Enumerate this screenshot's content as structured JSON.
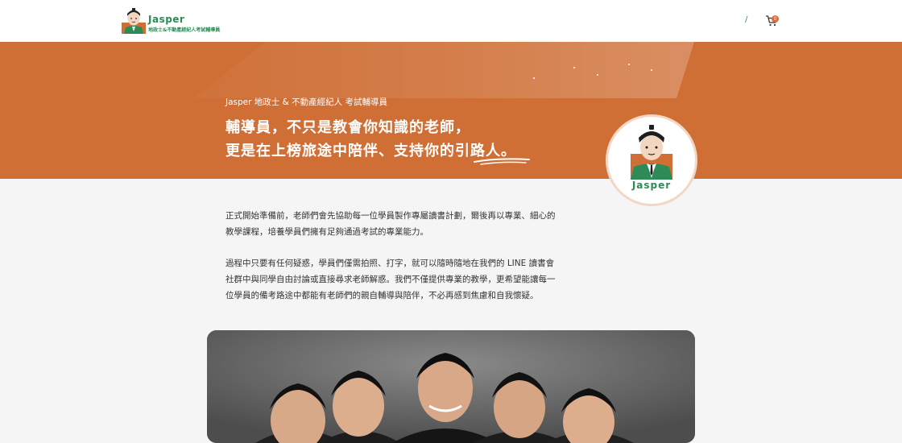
{
  "header": {
    "brand_name": "Jasper",
    "brand_tagline": "地政士&不動產經紀人考試輔導員",
    "nav_separator": "/",
    "cart_count": "0"
  },
  "hero": {
    "kicker": "Jasper 地政士 & 不動產經紀人 考試輔導員",
    "title_line1": "輔導員，不只是教會你知識的老師，",
    "title_line2": "更是在上榜旅途中陪伴、支持你的引路人。",
    "badge_name": "Jasper"
  },
  "content": {
    "p1_line1": "正式開始準備前，老師們會先協助每一位學員製作專屬讀書計劃，爾後再以專業、細心的",
    "p1_line2": "教學課程，培養學員們擁有足夠通過考試的專業能力。",
    "p2_line1": "過程中只要有任何疑惑，學員們僅需拍照、打字，就可以隨時隨地在我們的 LINE 讀書會",
    "p2_line2": "社群中與同學自由討論或直接尋求老師解惑。我們不僅提供專業的教學，更希望能讓每一",
    "p2_line3": "位學員的備考路途中都能有老師們的親自輔導與陪伴，不必再感到焦慮和自我懷疑。"
  },
  "colors": {
    "accent_orange": "#cf6f36",
    "brand_green": "#2e8b57",
    "background": "#f5f5f5"
  },
  "icons": {
    "cart": "shopping-cart-icon",
    "avatar": "jasper-avatar-icon"
  }
}
